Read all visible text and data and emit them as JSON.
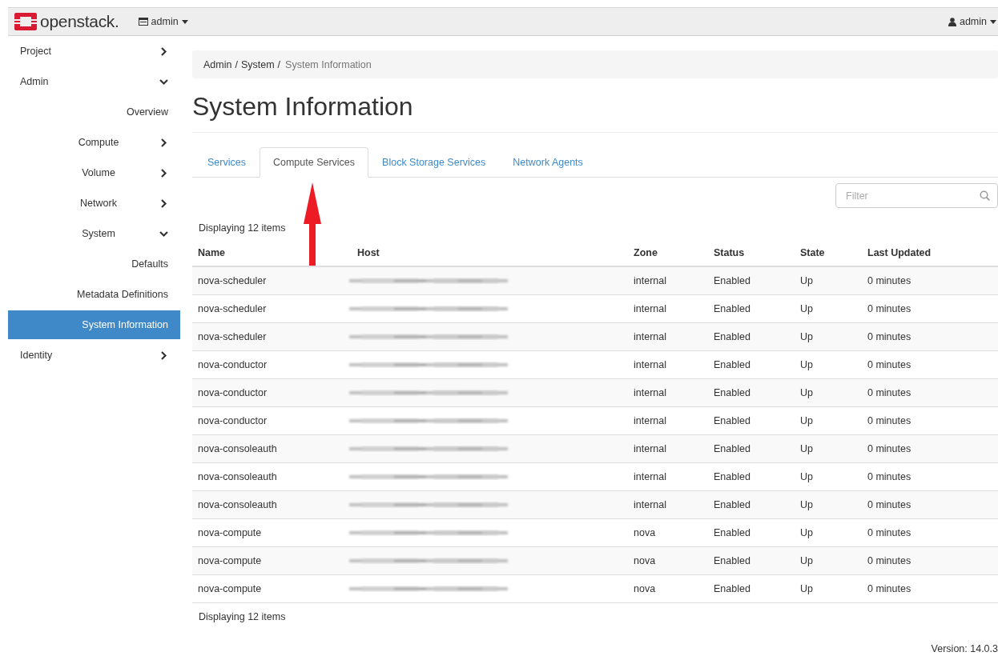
{
  "topbar": {
    "brand": "openstack.",
    "project_menu": "admin",
    "user_menu": "admin"
  },
  "sidebar": {
    "items": [
      {
        "label": "Project",
        "expanded": false,
        "selected": false
      },
      {
        "label": "Admin",
        "expanded": true,
        "selected": false,
        "children": [
          {
            "label": "Overview",
            "selected": false
          },
          {
            "label": "Compute",
            "expanded": false,
            "selected": false
          },
          {
            "label": "Volume",
            "expanded": false,
            "selected": false
          },
          {
            "label": "Network",
            "expanded": false,
            "selected": false
          },
          {
            "label": "System",
            "expanded": true,
            "selected": false,
            "children": [
              {
                "label": "Defaults",
                "selected": false
              },
              {
                "label": "Metadata Definitions",
                "selected": false
              },
              {
                "label": "System Information",
                "selected": true
              }
            ]
          }
        ]
      },
      {
        "label": "Identity",
        "expanded": false,
        "selected": false
      }
    ]
  },
  "breadcrumb": {
    "separator": "/",
    "items": [
      "Admin",
      "System",
      "System Information"
    ]
  },
  "page_title": "System Information",
  "tabs": [
    {
      "label": "Services",
      "selected": false
    },
    {
      "label": "Compute Services",
      "selected": true
    },
    {
      "label": "Block Storage Services",
      "selected": false
    },
    {
      "label": "Network Agents",
      "selected": false
    }
  ],
  "filter": {
    "placeholder": "Filter"
  },
  "item_count_top": "Displaying 12 items",
  "table": {
    "columns": [
      "Name",
      "Host",
      "Zone",
      "Status",
      "State",
      "Last Updated"
    ],
    "rows": [
      {
        "name": "nova-scheduler",
        "zone": "internal",
        "status": "Enabled",
        "state": "Up",
        "last_updated": "0 minutes"
      },
      {
        "name": "nova-scheduler",
        "zone": "internal",
        "status": "Enabled",
        "state": "Up",
        "last_updated": "0 minutes"
      },
      {
        "name": "nova-scheduler",
        "zone": "internal",
        "status": "Enabled",
        "state": "Up",
        "last_updated": "0 minutes"
      },
      {
        "name": "nova-conductor",
        "zone": "internal",
        "status": "Enabled",
        "state": "Up",
        "last_updated": "0 minutes"
      },
      {
        "name": "nova-conductor",
        "zone": "internal",
        "status": "Enabled",
        "state": "Up",
        "last_updated": "0 minutes"
      },
      {
        "name": "nova-conductor",
        "zone": "internal",
        "status": "Enabled",
        "state": "Up",
        "last_updated": "0 minutes"
      },
      {
        "name": "nova-consoleauth",
        "zone": "internal",
        "status": "Enabled",
        "state": "Up",
        "last_updated": "0 minutes"
      },
      {
        "name": "nova-consoleauth",
        "zone": "internal",
        "status": "Enabled",
        "state": "Up",
        "last_updated": "0 minutes"
      },
      {
        "name": "nova-consoleauth",
        "zone": "internal",
        "status": "Enabled",
        "state": "Up",
        "last_updated": "0 minutes"
      },
      {
        "name": "nova-compute",
        "zone": "nova",
        "status": "Enabled",
        "state": "Up",
        "last_updated": "0 minutes"
      },
      {
        "name": "nova-compute",
        "zone": "nova",
        "status": "Enabled",
        "state": "Up",
        "last_updated": "0 minutes"
      },
      {
        "name": "nova-compute",
        "zone": "nova",
        "status": "Enabled",
        "state": "Up",
        "last_updated": "0 minutes"
      }
    ]
  },
  "item_count_bottom": "Displaying 12 items",
  "version": "Version: 14.0.3"
}
